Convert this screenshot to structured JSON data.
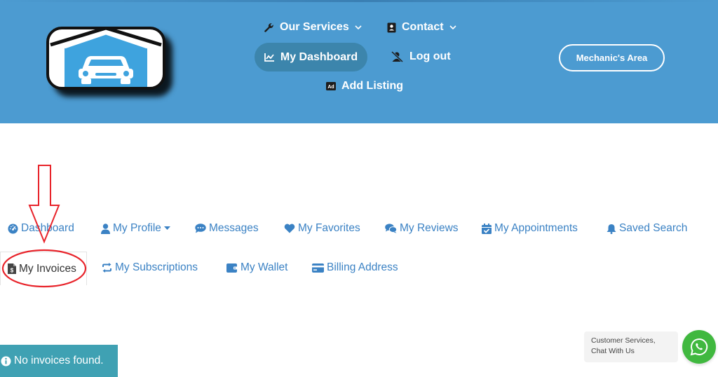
{
  "header": {
    "nav": {
      "services": "Our Services",
      "contact": "Contact",
      "dashboard": "My Dashboard",
      "logout": "Log out",
      "add_listing": "Add Listing",
      "add_listing_badge": "Ad"
    },
    "mechanic_button": "Mechanic's Area"
  },
  "dashboard_menu": {
    "items": [
      {
        "label": "Dashboard",
        "icon": "tachometer-icon"
      },
      {
        "label": "My Profile",
        "icon": "user-icon"
      },
      {
        "label": "Messages",
        "icon": "chat-icon"
      },
      {
        "label": "My Favorites",
        "icon": "heart-icon"
      },
      {
        "label": "My Reviews",
        "icon": "comments-icon"
      },
      {
        "label": "My Appointments",
        "icon": "calendar-check-icon"
      },
      {
        "label": "Saved Search",
        "icon": "bell-icon"
      },
      {
        "label": "My Invoices",
        "icon": "invoice-icon",
        "active": true
      },
      {
        "label": "My Subscriptions",
        "icon": "sync-icon"
      },
      {
        "label": "My Wallet",
        "icon": "wallet-icon"
      },
      {
        "label": "Billing Address",
        "icon": "credit-card-icon"
      }
    ]
  },
  "alert": {
    "text": "No invoices found.",
    "icon": "info-icon"
  },
  "chat": {
    "text": "Customer Services, Chat With Us",
    "icon": "whatsapp-icon"
  },
  "colors": {
    "header_bg": "#4c9bd1",
    "dashboard_pill": "#3c85ac",
    "menu_link": "#3b82c4",
    "alert_bg": "#3fa1b3",
    "whatsapp": "#40b83f",
    "annotation": "#e8232a"
  }
}
